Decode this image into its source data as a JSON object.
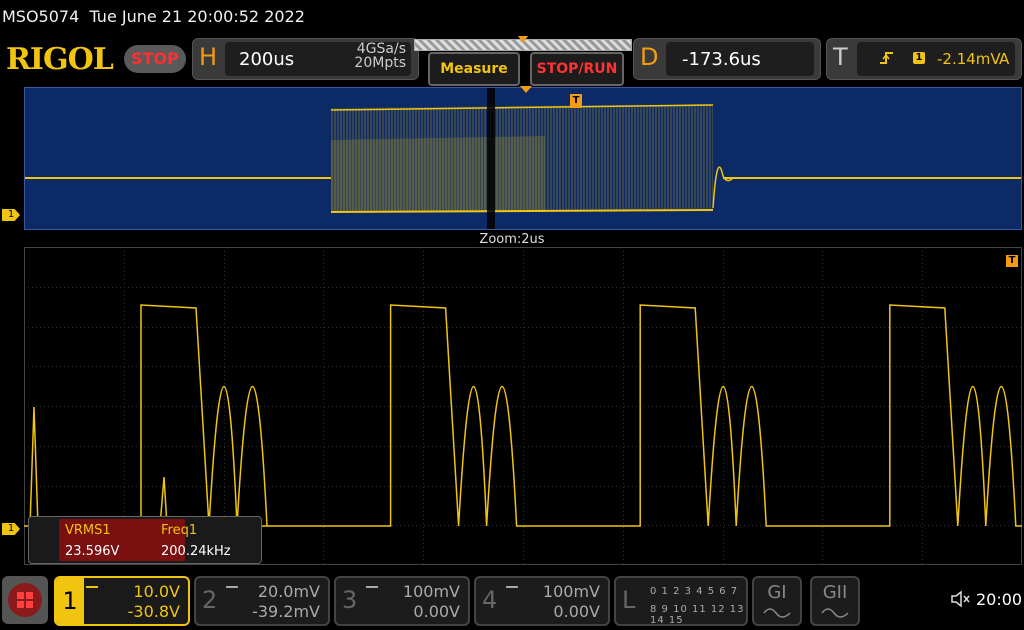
{
  "title_bar": {
    "model": "MSO5074",
    "datetime": "Tue June 21 20:00:52 2022"
  },
  "brand": {
    "logo": "RIGOL",
    "run_state": "STOP"
  },
  "horizontal": {
    "tag": "H",
    "timebase": "200us",
    "sample_rate": "4GSa/s",
    "memory_depth": "20Mpts"
  },
  "buttons": {
    "measure": "Measure",
    "stop_run": "STOP/RUN"
  },
  "delay": {
    "tag": "D",
    "value": "-173.6us"
  },
  "trigger": {
    "tag": "T",
    "channel": "1",
    "level": "-2.14mV",
    "mode": "A"
  },
  "zoom_label": "Zoom:2us",
  "trigger_marker": "T",
  "channel_marker": "1",
  "measurements": [
    {
      "name": "VRMS1",
      "value": "23.596V"
    },
    {
      "name": "Freq1",
      "value": "200.24kHz"
    }
  ],
  "channels": [
    {
      "num": "1",
      "scale": "10.0V",
      "offset": "-30.8V",
      "active": true
    },
    {
      "num": "2",
      "scale": "20.0mV",
      "offset": "-39.2mV",
      "active": false
    },
    {
      "num": "3",
      "scale": "100mV",
      "offset": "0.00V",
      "active": false
    },
    {
      "num": "4",
      "scale": "100mV",
      "offset": "0.00V",
      "active": false
    }
  ],
  "logic": {
    "tag": "L",
    "row1": "0 1 2 3  4 5 6 7",
    "row2": "8 9 10 11 12 13 14 15"
  },
  "generators": {
    "g1": "GI",
    "g2": "GII"
  },
  "clock": "20:00",
  "colors": {
    "ch1": "#f1c40f",
    "overview_bg": "#0b2a66",
    "accent": "#f39c12",
    "stop": "#ff3030"
  }
}
